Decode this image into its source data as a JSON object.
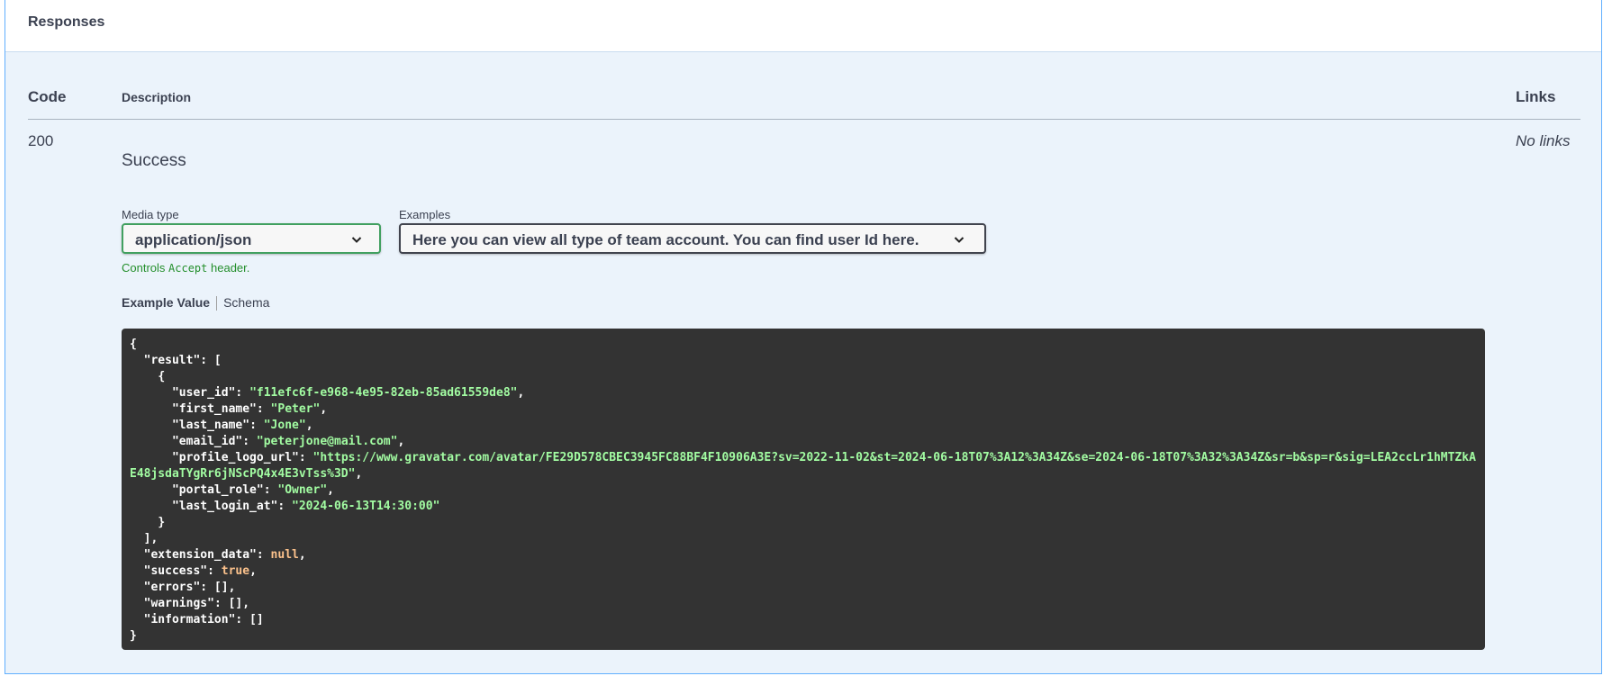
{
  "responses": {
    "title": "Responses",
    "columns": {
      "code": "Code",
      "description": "Description",
      "links": "Links"
    },
    "rows": [
      {
        "code": "200",
        "description": "Success",
        "links": "No links",
        "media_type": {
          "label": "Media type",
          "value": "application/json",
          "note_prefix": "Controls ",
          "note_code": "Accept",
          "note_suffix": " header."
        },
        "examples": {
          "label": "Examples",
          "value": "Here you can view all type of team account. You can find user Id here."
        },
        "tabs": {
          "example_value": "Example Value",
          "schema": "Schema"
        },
        "example_json": {
          "result": [
            {
              "user_id": "f11efc6f-e968-4e95-82eb-85ad61559de8",
              "first_name": "Peter",
              "last_name": "Jone",
              "email_id": "peterjone@mail.com",
              "profile_logo_url": "https://www.gravatar.com/avatar/FE29D578CBEC3945FC88BF4F10906A3E?sv=2022-11-02&st=2024-06-18T07%3A12%3A34Z&se=2024-06-18T07%3A32%3A34Z&sr=b&sp=r&sig=LEA2ccLr1hMTZkAE48jsdaTYgRr6jNScPQ4x4E3vTss%3D",
              "portal_role": "Owner",
              "last_login_at": "2024-06-13T14:30:00"
            }
          ],
          "extension_data": null,
          "success": true,
          "errors": [],
          "warnings": [],
          "information": []
        }
      }
    ]
  },
  "colors": {
    "panel_bg": "#ebf3fb",
    "panel_border": "#61affe",
    "code_bg": "#333333",
    "string": "#a2fca2",
    "literal": "#fcc28c",
    "media_border": "#41a060",
    "note": "#248f2c"
  },
  "icons": {
    "select_arrow": "chevron-down-icon"
  }
}
